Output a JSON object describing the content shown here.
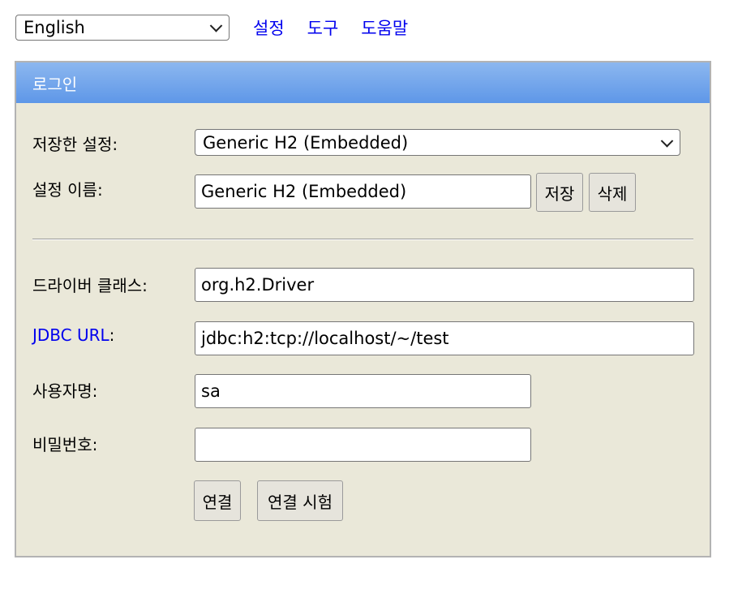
{
  "topbar": {
    "language": "English",
    "links": [
      "설정",
      "도구",
      "도움말"
    ]
  },
  "panel": {
    "title": "로그인",
    "saved_settings": {
      "label": "저장한 설정:",
      "value": "Generic H2 (Embedded)"
    },
    "setting_name": {
      "label": "설정 이름:",
      "value": "Generic H2 (Embedded)"
    },
    "save_label": "저장",
    "delete_label": "삭제",
    "driver_class": {
      "label": "드라이버 클래스:",
      "value": "org.h2.Driver"
    },
    "jdbc_url": {
      "label_link": "JDBC URL",
      "label_suffix": ":",
      "value": "jdbc:h2:tcp://localhost/~/test"
    },
    "username": {
      "label": "사용자명:",
      "value": "sa"
    },
    "password": {
      "label": "비밀번호:",
      "value": ""
    },
    "connect_label": "연결",
    "test_connection_label": "연결 시험"
  },
  "colors": {
    "header_gradient_top": "#8cb7ef",
    "header_gradient_bottom": "#5e97e8",
    "panel_background": "#eae8d9",
    "link": "#0000ee"
  }
}
